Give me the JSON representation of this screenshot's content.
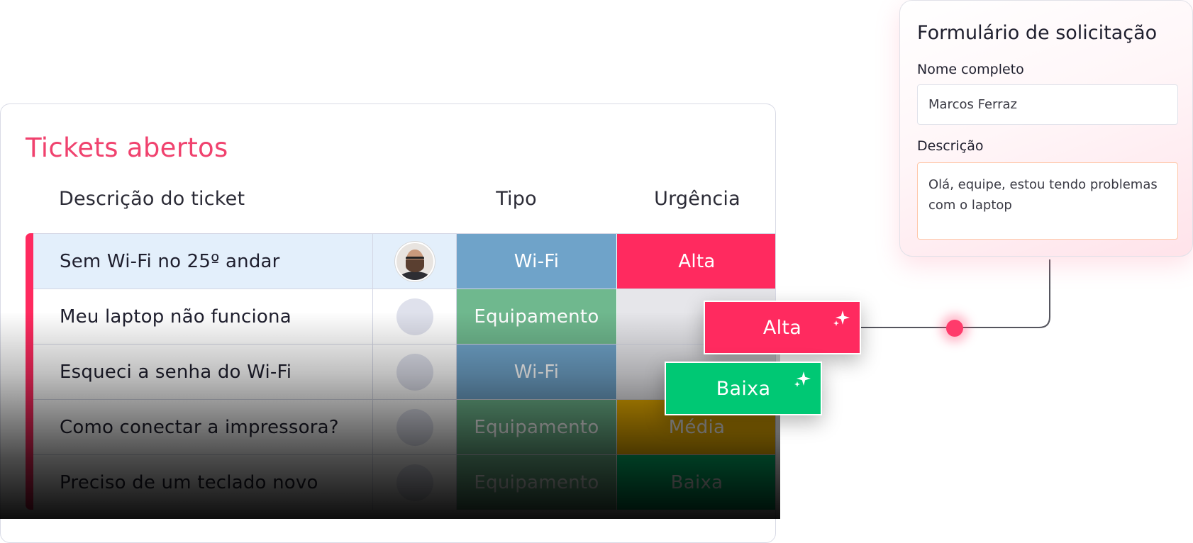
{
  "board": {
    "title": "Tickets abertos",
    "columns": {
      "description": "Descrição do ticket",
      "type": "Tipo",
      "urgency": "Urgência"
    },
    "rows": [
      {
        "description": "Sem Wi-Fi no 25º andar",
        "person": "avatar-photo",
        "type": "Wi-Fi",
        "urgency": "Alta",
        "type_color": "#6fa3c9",
        "urgency_color": "#ff2a5f",
        "highlighted": true
      },
      {
        "description": "Meu laptop não funciona",
        "person": "avatar-empty",
        "type": "Equipamento",
        "type_color": "#6fb88e",
        "urgency": "",
        "urgency_color": "#e6e6ea"
      },
      {
        "description": "Esqueci a senha do Wi-Fi",
        "person": "avatar-empty",
        "type": "Wi-Fi",
        "type_color": "#6fa3c9",
        "urgency": "",
        "urgency_color": "#e6e6ea"
      },
      {
        "description": "Como conectar a impressora?",
        "person": "avatar-empty",
        "type": "Equipamento",
        "type_color": "#6fb88e",
        "urgency": "Média",
        "urgency_color": "#f2b400"
      },
      {
        "description": "Preciso de um teclado novo",
        "person": "avatar-empty",
        "type": "Equipamento",
        "type_color": "#6fb88e",
        "urgency": "Baixa",
        "urgency_color": "#00c874"
      }
    ]
  },
  "ai_tags": [
    {
      "label": "Alta",
      "color": "#ff2a5f",
      "icon": "sparkle-icon"
    },
    {
      "label": "Baixa",
      "color": "#00c874",
      "icon": "sparkle-icon"
    }
  ],
  "form": {
    "title": "Formulário de solicitação",
    "name_label": "Nome completo",
    "name_value": "Marcos Ferraz",
    "description_label": "Descrição",
    "description_value": "Olá, equipe, estou tendo problemas com o laptop"
  },
  "colors": {
    "accent": "#ff2a5f",
    "title": "#f0426e",
    "row_highlight": "#e3effb",
    "grid": "#d3d6e4"
  }
}
